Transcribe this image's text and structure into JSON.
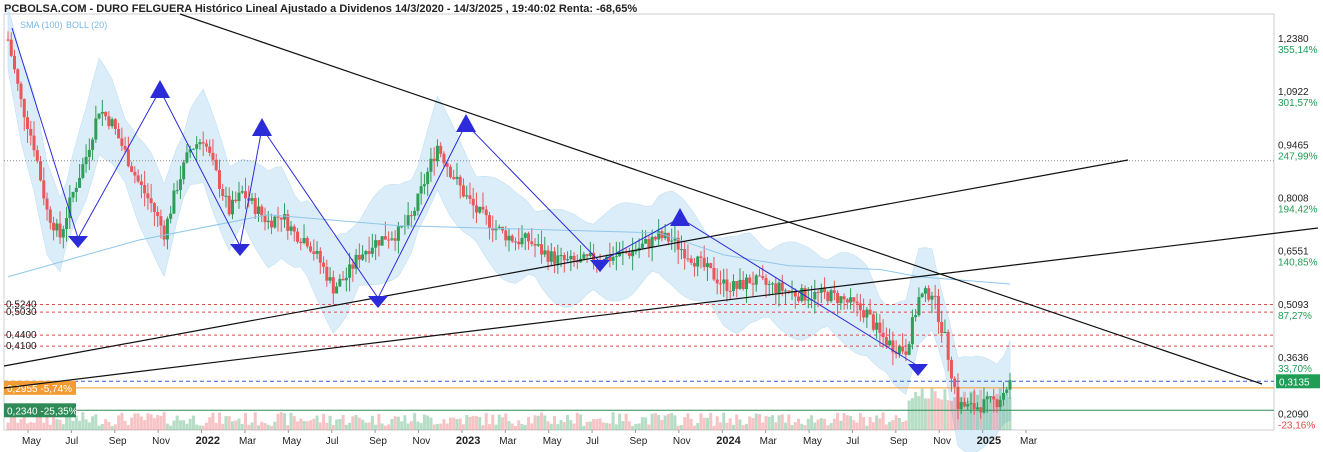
{
  "title": "PCBOLSA.COM - DURO FELGUERA Histórico Lineal Ajustado a Dividenos 14/3/2020 - 14/3/2025 , 19:40:02 Renta: -68,65%",
  "legend": {
    "sma": "SMA (100)",
    "boll": "BOLL (20)"
  },
  "colors": {
    "up": "#2e9e58",
    "down": "#e8575a",
    "band": "#d5eaf8",
    "sma": "#8fc7ea",
    "trend": "#111111",
    "zigzag": "#2b2bd9",
    "dash_red": "#e24a4a",
    "dash_blue": "#3b5bd6",
    "orange": "#f39c33",
    "green": "#2e8b57",
    "badge_blue": "#1f9d55"
  },
  "chart_data": {
    "type": "candlestick",
    "ylim": [
      0.18,
      1.32
    ],
    "price_ticks": [
      {
        "value": 1.238,
        "label": "1,2380",
        "pct": "355,14%"
      },
      {
        "value": 1.0922,
        "label": "1,0922",
        "pct": "301,57%"
      },
      {
        "value": 0.9465,
        "label": "0,9465",
        "pct": "247,99%"
      },
      {
        "value": 0.8008,
        "label": "0,8008",
        "pct": "194,42%"
      },
      {
        "value": 0.6551,
        "label": "0,6551",
        "pct": "140,85%"
      },
      {
        "value": 0.5093,
        "label": "0,5093",
        "pct": "87,27%"
      },
      {
        "value": 0.3636,
        "label": "0,3636",
        "pct": "33,70%"
      },
      {
        "value": 0.209,
        "label": "0,2090",
        "pct": "-23,16%"
      }
    ],
    "current_price": "0,3135",
    "x_labels": [
      "May",
      "Jul",
      "Sep",
      "Nov",
      "2022",
      "Mar",
      "May",
      "Jul",
      "Sep",
      "Nov",
      "2023",
      "Mar",
      "May",
      "Jul",
      "Sep",
      "Nov",
      "2024",
      "Mar",
      "May",
      "Jul",
      "Sep",
      "Nov",
      "2025",
      "Mar"
    ],
    "x_label_bold": [
      "2022",
      "2023",
      "2024",
      "2025"
    ],
    "levels": [
      {
        "value": 0.524,
        "label": "0,5240",
        "style": "dash_red"
      },
      {
        "value": 0.503,
        "label": "0,5030",
        "style": "dash_red"
      },
      {
        "value": 0.44,
        "label": "0,4400",
        "style": "dash_red"
      },
      {
        "value": 0.41,
        "label": "0,4100",
        "style": "dash_red"
      },
      {
        "value": 0.3135,
        "label": "",
        "style": "dash_blue"
      },
      {
        "value": 0.2955,
        "label": "0,2955 -5,74%",
        "style": "orange"
      },
      {
        "value": 0.234,
        "label": "0,2340 -25,35%",
        "style": "green"
      },
      {
        "value": 0.918,
        "label": "",
        "style": "dot_gray"
      }
    ],
    "price_path": [
      [
        0,
        1.25
      ],
      [
        1,
        1.08
      ],
      [
        2,
        0.96
      ],
      [
        3,
        0.78
      ],
      [
        4,
        0.71
      ],
      [
        5,
        0.83
      ],
      [
        6,
        0.93
      ],
      [
        7,
        1.06
      ],
      [
        8,
        1.02
      ],
      [
        9,
        0.94
      ],
      [
        10,
        0.86
      ],
      [
        11,
        0.8
      ],
      [
        12,
        0.72
      ],
      [
        13,
        0.85
      ],
      [
        14,
        0.95
      ],
      [
        15,
        0.98
      ],
      [
        16,
        0.88
      ],
      [
        17,
        0.78
      ],
      [
        18,
        0.83
      ],
      [
        19,
        0.79
      ],
      [
        20,
        0.75
      ],
      [
        21,
        0.77
      ],
      [
        22,
        0.72
      ],
      [
        23,
        0.7
      ],
      [
        24,
        0.64
      ],
      [
        25,
        0.57
      ],
      [
        26,
        0.6
      ],
      [
        27,
        0.66
      ],
      [
        28,
        0.69
      ],
      [
        29,
        0.71
      ],
      [
        30,
        0.72
      ],
      [
        31,
        0.76
      ],
      [
        32,
        0.86
      ],
      [
        33,
        0.96
      ],
      [
        34,
        0.89
      ],
      [
        35,
        0.83
      ],
      [
        36,
        0.78
      ],
      [
        37,
        0.75
      ],
      [
        38,
        0.72
      ],
      [
        39,
        0.7
      ],
      [
        40,
        0.7
      ],
      [
        41,
        0.67
      ],
      [
        42,
        0.65
      ],
      [
        43,
        0.64
      ],
      [
        44,
        0.64
      ],
      [
        45,
        0.65
      ],
      [
        46,
        0.65
      ],
      [
        47,
        0.66
      ],
      [
        48,
        0.67
      ],
      [
        49,
        0.69
      ],
      [
        50,
        0.71
      ],
      [
        51,
        0.7
      ],
      [
        52,
        0.67
      ],
      [
        53,
        0.64
      ],
      [
        54,
        0.61
      ],
      [
        55,
        0.58
      ],
      [
        56,
        0.57
      ],
      [
        57,
        0.59
      ],
      [
        58,
        0.58
      ],
      [
        59,
        0.57
      ],
      [
        60,
        0.56
      ],
      [
        61,
        0.55
      ],
      [
        62,
        0.55
      ],
      [
        63,
        0.55
      ],
      [
        64,
        0.54
      ],
      [
        65,
        0.52
      ],
      [
        66,
        0.5
      ],
      [
        67,
        0.44
      ],
      [
        68,
        0.41
      ],
      [
        69,
        0.4
      ],
      [
        70,
        0.54
      ],
      [
        71,
        0.56
      ],
      [
        72,
        0.43
      ],
      [
        73,
        0.25
      ],
      [
        74,
        0.24
      ],
      [
        75,
        0.25
      ],
      [
        76,
        0.26
      ],
      [
        77,
        0.31
      ]
    ],
    "sma100": [
      [
        0,
        0.6
      ],
      [
        10,
        0.7
      ],
      [
        20,
        0.77
      ],
      [
        30,
        0.74
      ],
      [
        40,
        0.73
      ],
      [
        50,
        0.72
      ],
      [
        55,
        0.66
      ],
      [
        60,
        0.63
      ],
      [
        67,
        0.62
      ],
      [
        70,
        0.6
      ],
      [
        77,
        0.58
      ]
    ]
  }
}
